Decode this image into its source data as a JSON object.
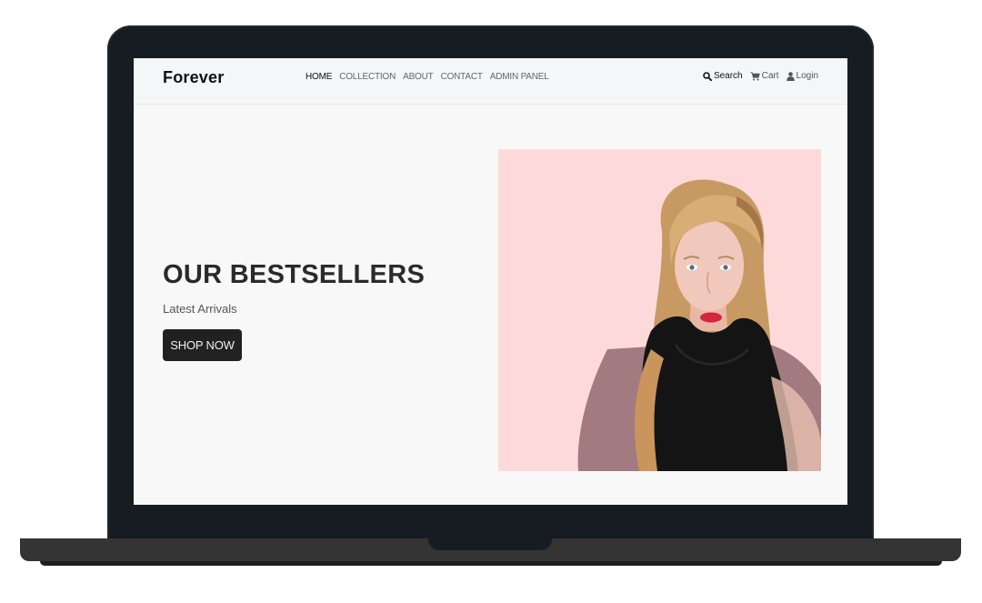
{
  "navbar": {
    "brand": "Forever",
    "links": [
      {
        "label": "HOME",
        "active": true
      },
      {
        "label": "COLLECTION",
        "active": false
      },
      {
        "label": "ABOUT",
        "active": false
      },
      {
        "label": "CONTACT",
        "active": false
      },
      {
        "label": "ADMIN PANEL",
        "active": false
      }
    ],
    "actions": {
      "search": {
        "label": "Search",
        "icon": "search-icon"
      },
      "cart": {
        "label": "Cart",
        "icon": "cart-icon"
      },
      "login": {
        "label": "Login",
        "icon": "user-icon"
      }
    }
  },
  "hero": {
    "title": "OUR BESTSELLERS",
    "subtitle": "Latest Arrivals",
    "button_label": "SHOP NOW",
    "image_background": "#fddad9"
  },
  "colors": {
    "bezel": "#161c21",
    "button": "#212121",
    "page_background": "#f8f8f8"
  }
}
